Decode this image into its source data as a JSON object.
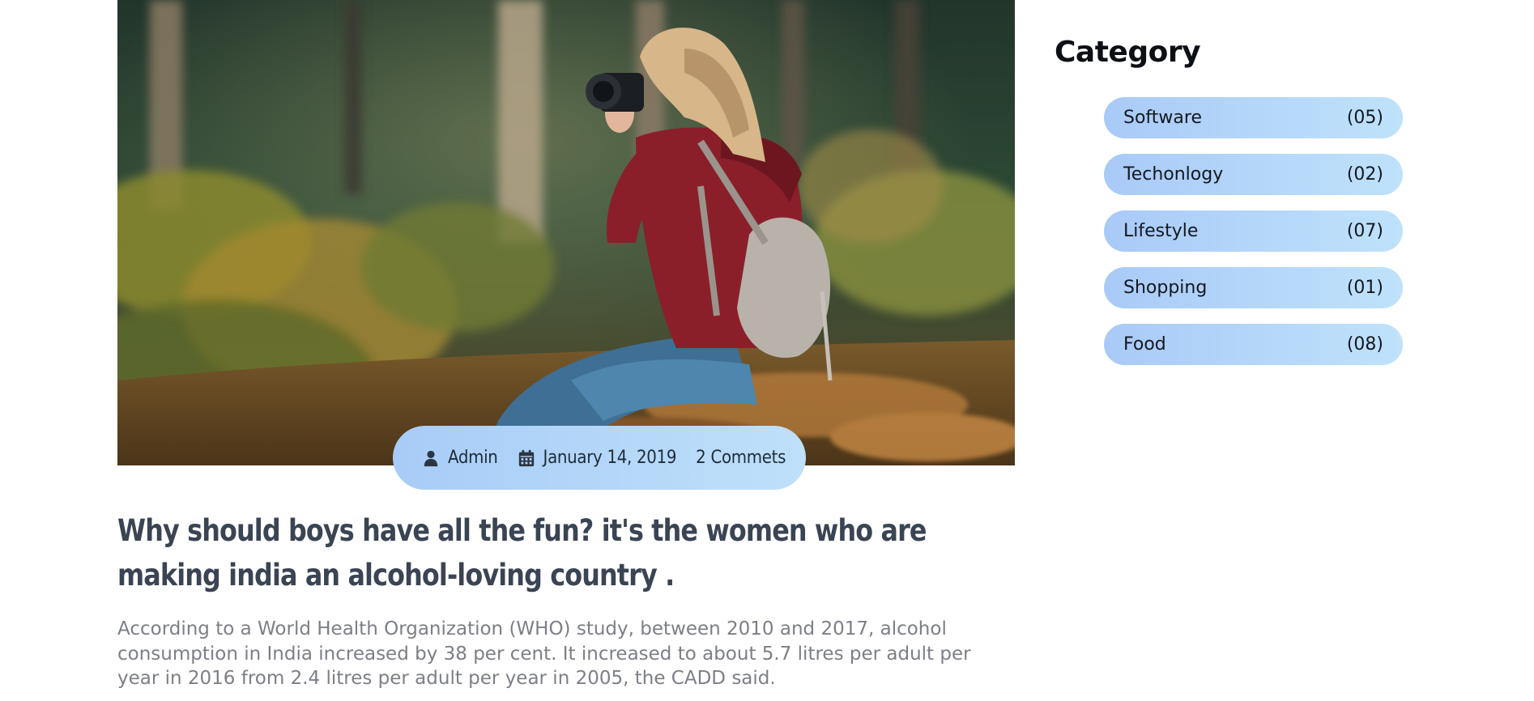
{
  "post": {
    "meta": {
      "author": "Admin",
      "date": "January 14, 2019",
      "comments": "2 Commets"
    },
    "title": "Why should boys have all the fun? it's the women who are making india an alcohol-loving country .",
    "excerpt": "According to a World Health Organization (WHO) study, between 2010 and 2017, alcohol consumption in India increased by 38 per cent. It increased to about 5.7 litres per adult per year in 2016 from 2.4 litres per adult per year in 2005, the CADD said."
  },
  "sidebar": {
    "title": "Category",
    "categories": [
      {
        "label": "Software",
        "count": "(05)"
      },
      {
        "label": "Techonlogy",
        "count": "(02)"
      },
      {
        "label": "Lifestyle",
        "count": "(07)"
      },
      {
        "label": "Shopping",
        "count": "(01)"
      },
      {
        "label": "Food",
        "count": "(08)"
      }
    ]
  },
  "icons": {
    "author": "user-icon",
    "date": "calendar-icon"
  },
  "colors": {
    "pill_start": "#a8ccf7",
    "pill_end": "#bfe0fa",
    "title": "#3a4453",
    "excerpt": "#7c7f86"
  }
}
